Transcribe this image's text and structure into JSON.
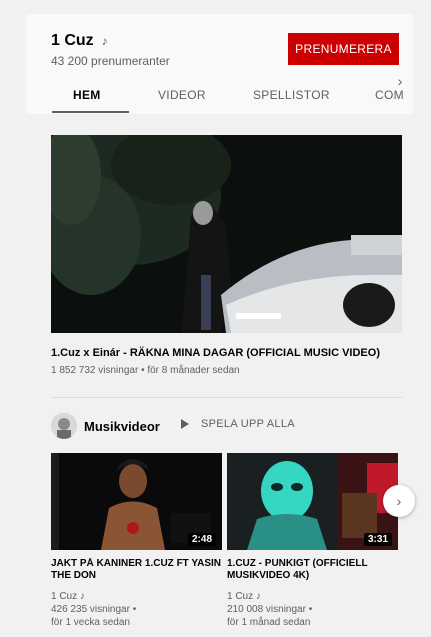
{
  "channel": {
    "name": "1 Cuz",
    "verified_icon": "music-note-icon",
    "subscribers": "43 200 prenumeranter",
    "subscribe_label": "PRENUMERERA",
    "subscribe_color": "#cc0000"
  },
  "tabs": [
    {
      "label": "HEM",
      "active": true
    },
    {
      "label": "VIDEOR",
      "active": false
    },
    {
      "label": "SPELLISTOR",
      "active": false
    },
    {
      "label": "COM",
      "active": false
    }
  ],
  "featured": {
    "title": "1.Cuz x Einár - RÄKNA MINA DAGAR (OFFICIAL MUSIC VIDEO)",
    "meta": "1 852 732 visningar • för 8 månader sedan"
  },
  "shelf": {
    "title": "Musikvideor",
    "play_all_label": "SPELA UPP ALLA",
    "videos": [
      {
        "title": "JAKT PÅ KANINER 1.CUZ FT YASIN THE DON",
        "duration": "2:48",
        "channel": "1 Cuz",
        "views": "426 235 visningar •",
        "age": "för 1 vecka sedan"
      },
      {
        "title": "1.CUZ - PUNKIGT (OFFICIELL MUSIKVIDEO 4K)",
        "duration": "3:31",
        "channel": "1 Cuz",
        "views": "210 008 visningar •",
        "age": "för 1 månad sedan"
      }
    ]
  }
}
